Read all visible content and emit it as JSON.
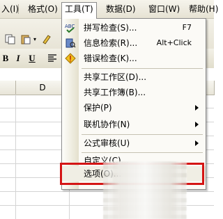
{
  "menubar": {
    "items": [
      "入(I)",
      "格式(O)",
      "工具(T)",
      "数据(D)",
      "窗口(W)",
      "帮助(H)"
    ]
  },
  "grid": {
    "column_header": "D"
  },
  "tools_menu": {
    "items": [
      {
        "label": "拼写检查(S)...",
        "shortcut": "F7",
        "icon": "spelling-abc-icon"
      },
      {
        "label": "信息检索(R)...",
        "shortcut": "Alt+Click",
        "icon": "research-book-icon"
      },
      {
        "label": "错误检查(K)...",
        "icon": "error-check-diamond-icon"
      },
      {
        "label": "共享工作区(D)..."
      },
      {
        "label": "共享工作簿(B)..."
      },
      {
        "label": "保护(P)",
        "submenu": true
      },
      {
        "label": "联机协作(N)",
        "submenu": true
      },
      {
        "label": "公式审核(U)",
        "submenu": true
      },
      {
        "label": "自定义(C)..."
      },
      {
        "label": "选项(O)..."
      }
    ]
  },
  "colors": {
    "highlight_box": "#d41414",
    "menu_bg": "#fbfaf6",
    "toolbar_bg": "#ece9d8"
  }
}
